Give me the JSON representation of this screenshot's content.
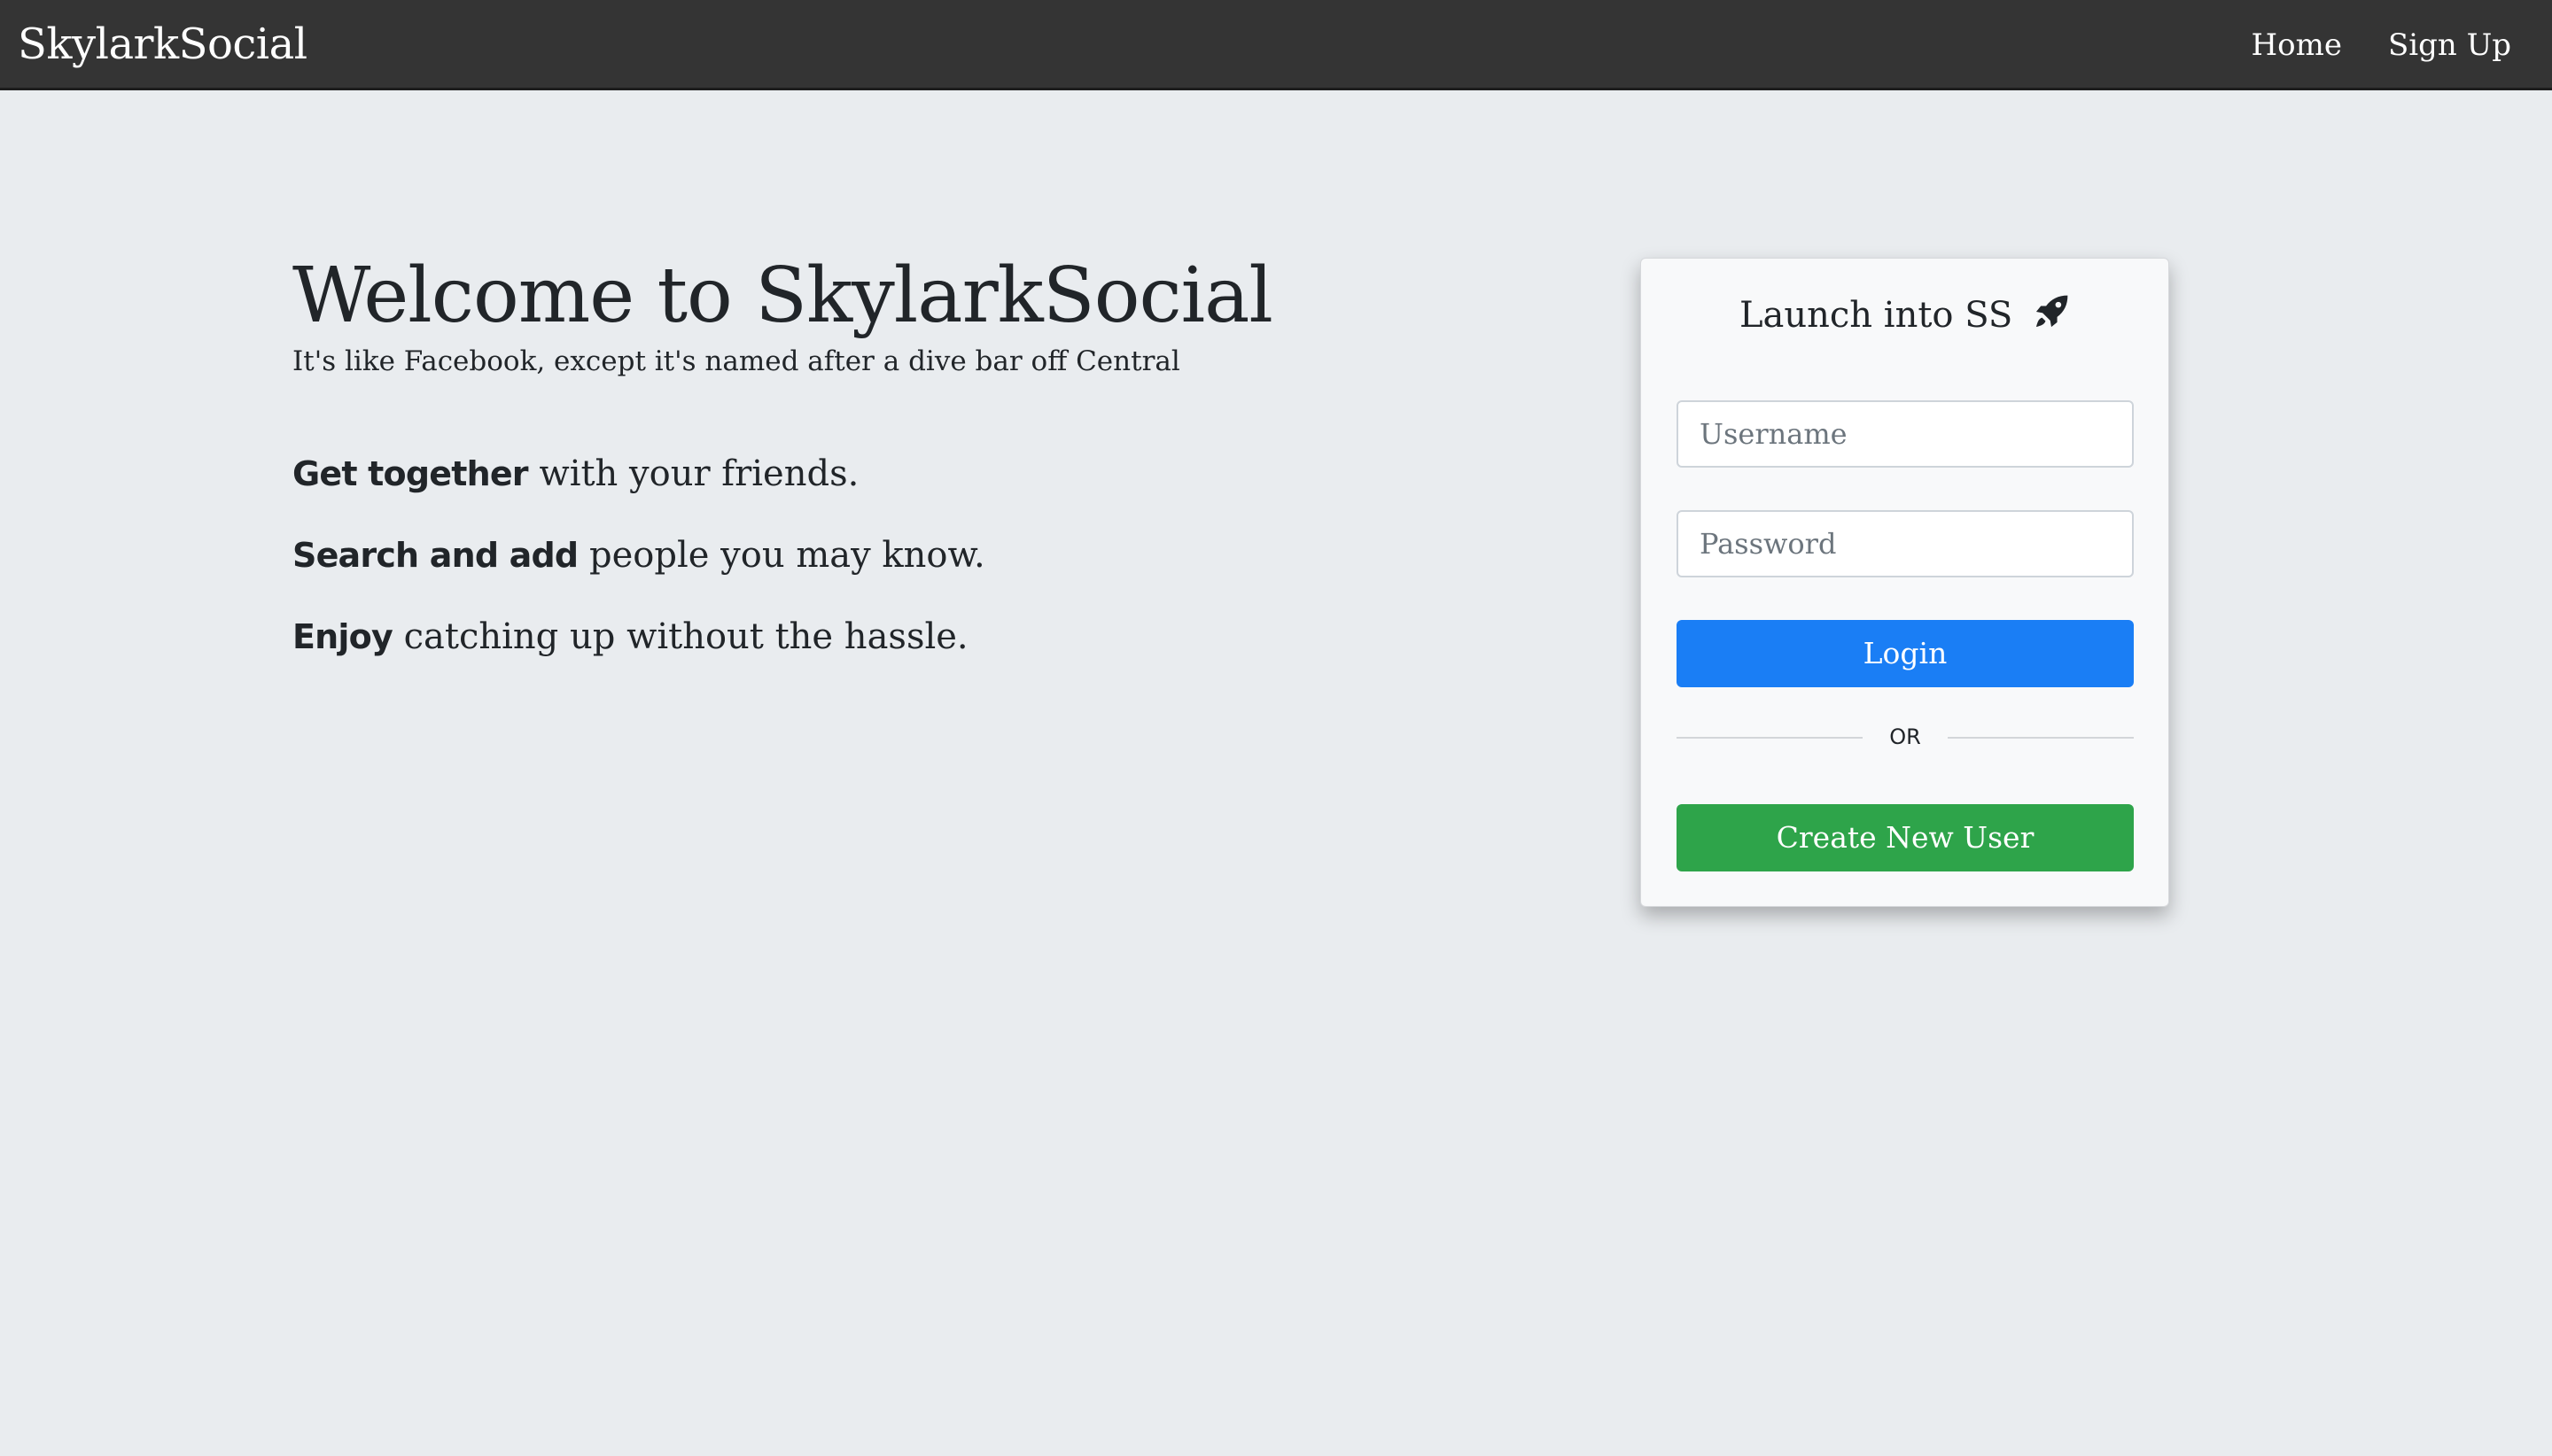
{
  "navbar": {
    "brand": "SkylarkSocial",
    "links": [
      "Home",
      "Sign Up"
    ]
  },
  "hero": {
    "title": "Welcome to SkylarkSocial",
    "subtitle": "It's like Facebook, except it's named after a dive bar off Central",
    "features": [
      {
        "bold": "Get together",
        "rest": " with your friends."
      },
      {
        "bold": "Search and add",
        "rest": " people you may know."
      },
      {
        "bold": "Enjoy",
        "rest": " catching up without the hassle."
      }
    ]
  },
  "login_card": {
    "title": "Launch into SS",
    "title_icon": "rocket-icon",
    "username_placeholder": "Username",
    "username_value": "",
    "password_placeholder": "Password",
    "password_value": "",
    "login_label": "Login",
    "divider_label": "OR",
    "create_label": "Create New User"
  },
  "colors": {
    "navbar_bg": "#343434",
    "page_bg": "#e9ecef",
    "login_button": "#1a7ef5",
    "create_button": "#2ea44a"
  }
}
